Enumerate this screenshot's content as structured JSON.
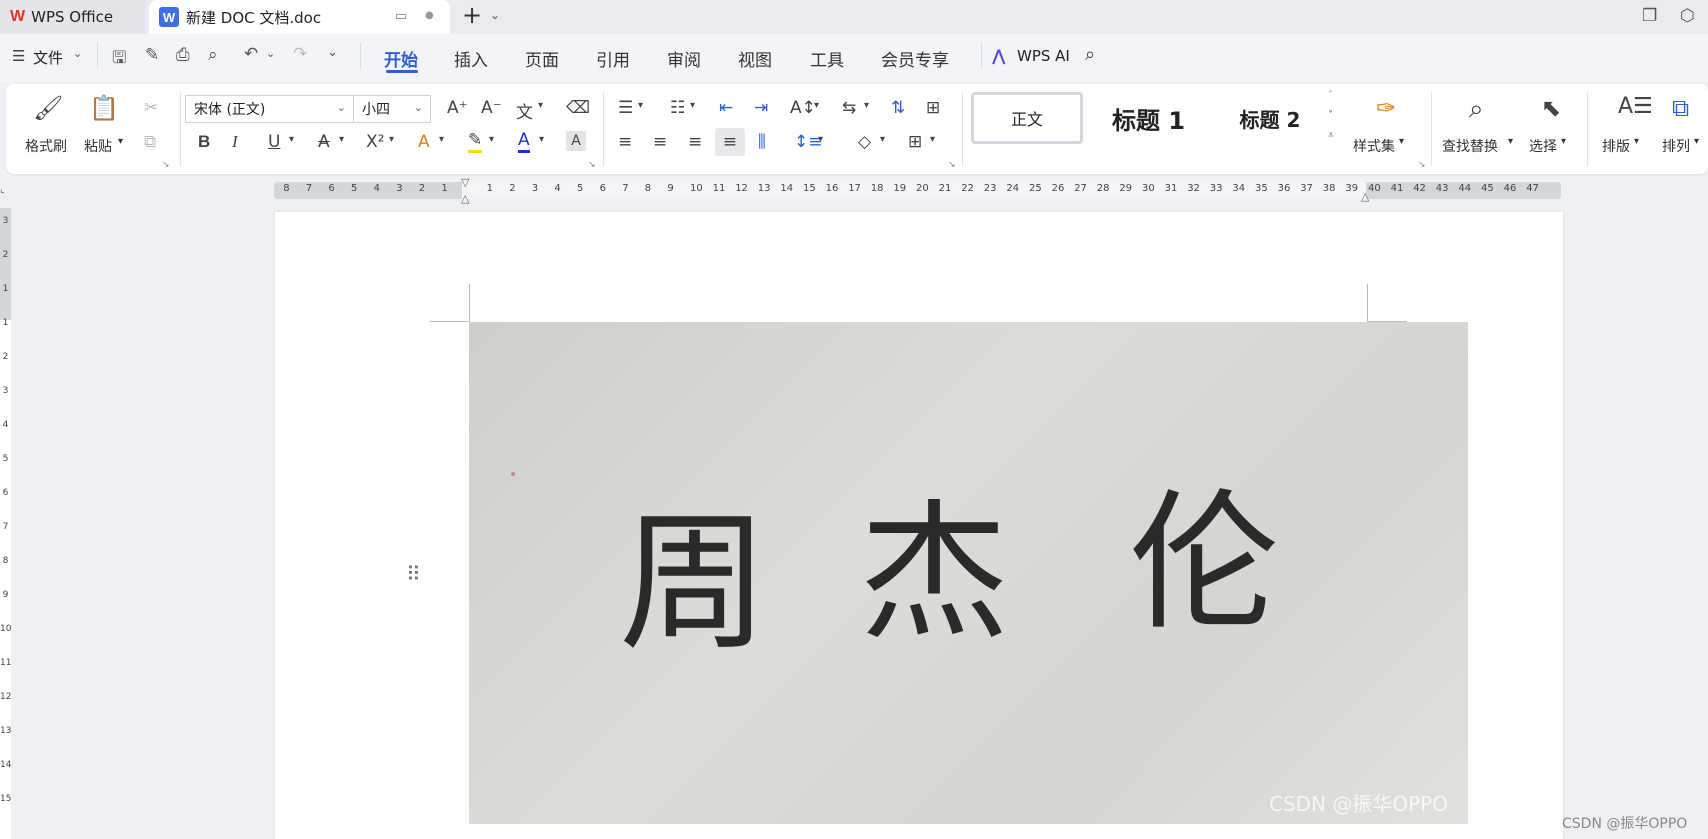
{
  "tabs": {
    "home_label": "WPS Office",
    "doc_logo": "W",
    "doc_title": "新建 DOC 文档.doc",
    "new_tab": "+"
  },
  "menubar": {
    "file_label": "文件",
    "tabs": [
      "开始",
      "插入",
      "页面",
      "引用",
      "审阅",
      "视图",
      "工具",
      "会员专享"
    ],
    "active_tab": "开始",
    "wps_ai_label": "WPS AI"
  },
  "ribbon": {
    "format_painter": "格式刷",
    "paste": "粘贴",
    "font_name": "宋体 (正文)",
    "font_size": "小四",
    "styles": [
      "正文",
      "标题 1",
      "标题 2"
    ],
    "style_set": "样式集",
    "find_replace": "查找替换",
    "select": "选择",
    "layout": "排版",
    "arrange": "排列"
  },
  "ruler": {
    "left_numbers": [
      "8",
      "7",
      "6",
      "5",
      "4",
      "3",
      "2",
      "1"
    ],
    "right_numbers": [
      "1",
      "2",
      "3",
      "4",
      "5",
      "6",
      "7",
      "8",
      "9",
      "10",
      "11",
      "12",
      "13",
      "14",
      "15",
      "16",
      "17",
      "18",
      "19",
      "20",
      "21",
      "22",
      "23",
      "24",
      "25",
      "26",
      "27",
      "28",
      "29",
      "30",
      "31",
      "32",
      "33",
      "34",
      "35",
      "36",
      "37",
      "38",
      "39",
      "40",
      "41",
      "42",
      "43",
      "44",
      "45",
      "46",
      "47"
    ],
    "vertical_numbers": [
      "3",
      "2",
      "1",
      "1",
      "2",
      "3",
      "4",
      "5",
      "6",
      "7",
      "8",
      "9",
      "10",
      "11",
      "12",
      "13",
      "14",
      "15"
    ]
  },
  "document": {
    "handwriting": [
      "周",
      "杰",
      "伦"
    ],
    "photo_watermark": "CSDN @振华OPPO"
  },
  "footer_watermark": "CSDN @振华OPPO",
  "colors": {
    "accent": "#2a5fd6",
    "wps_red": "#e4332b",
    "doc_blue": "#3e6ee8"
  }
}
